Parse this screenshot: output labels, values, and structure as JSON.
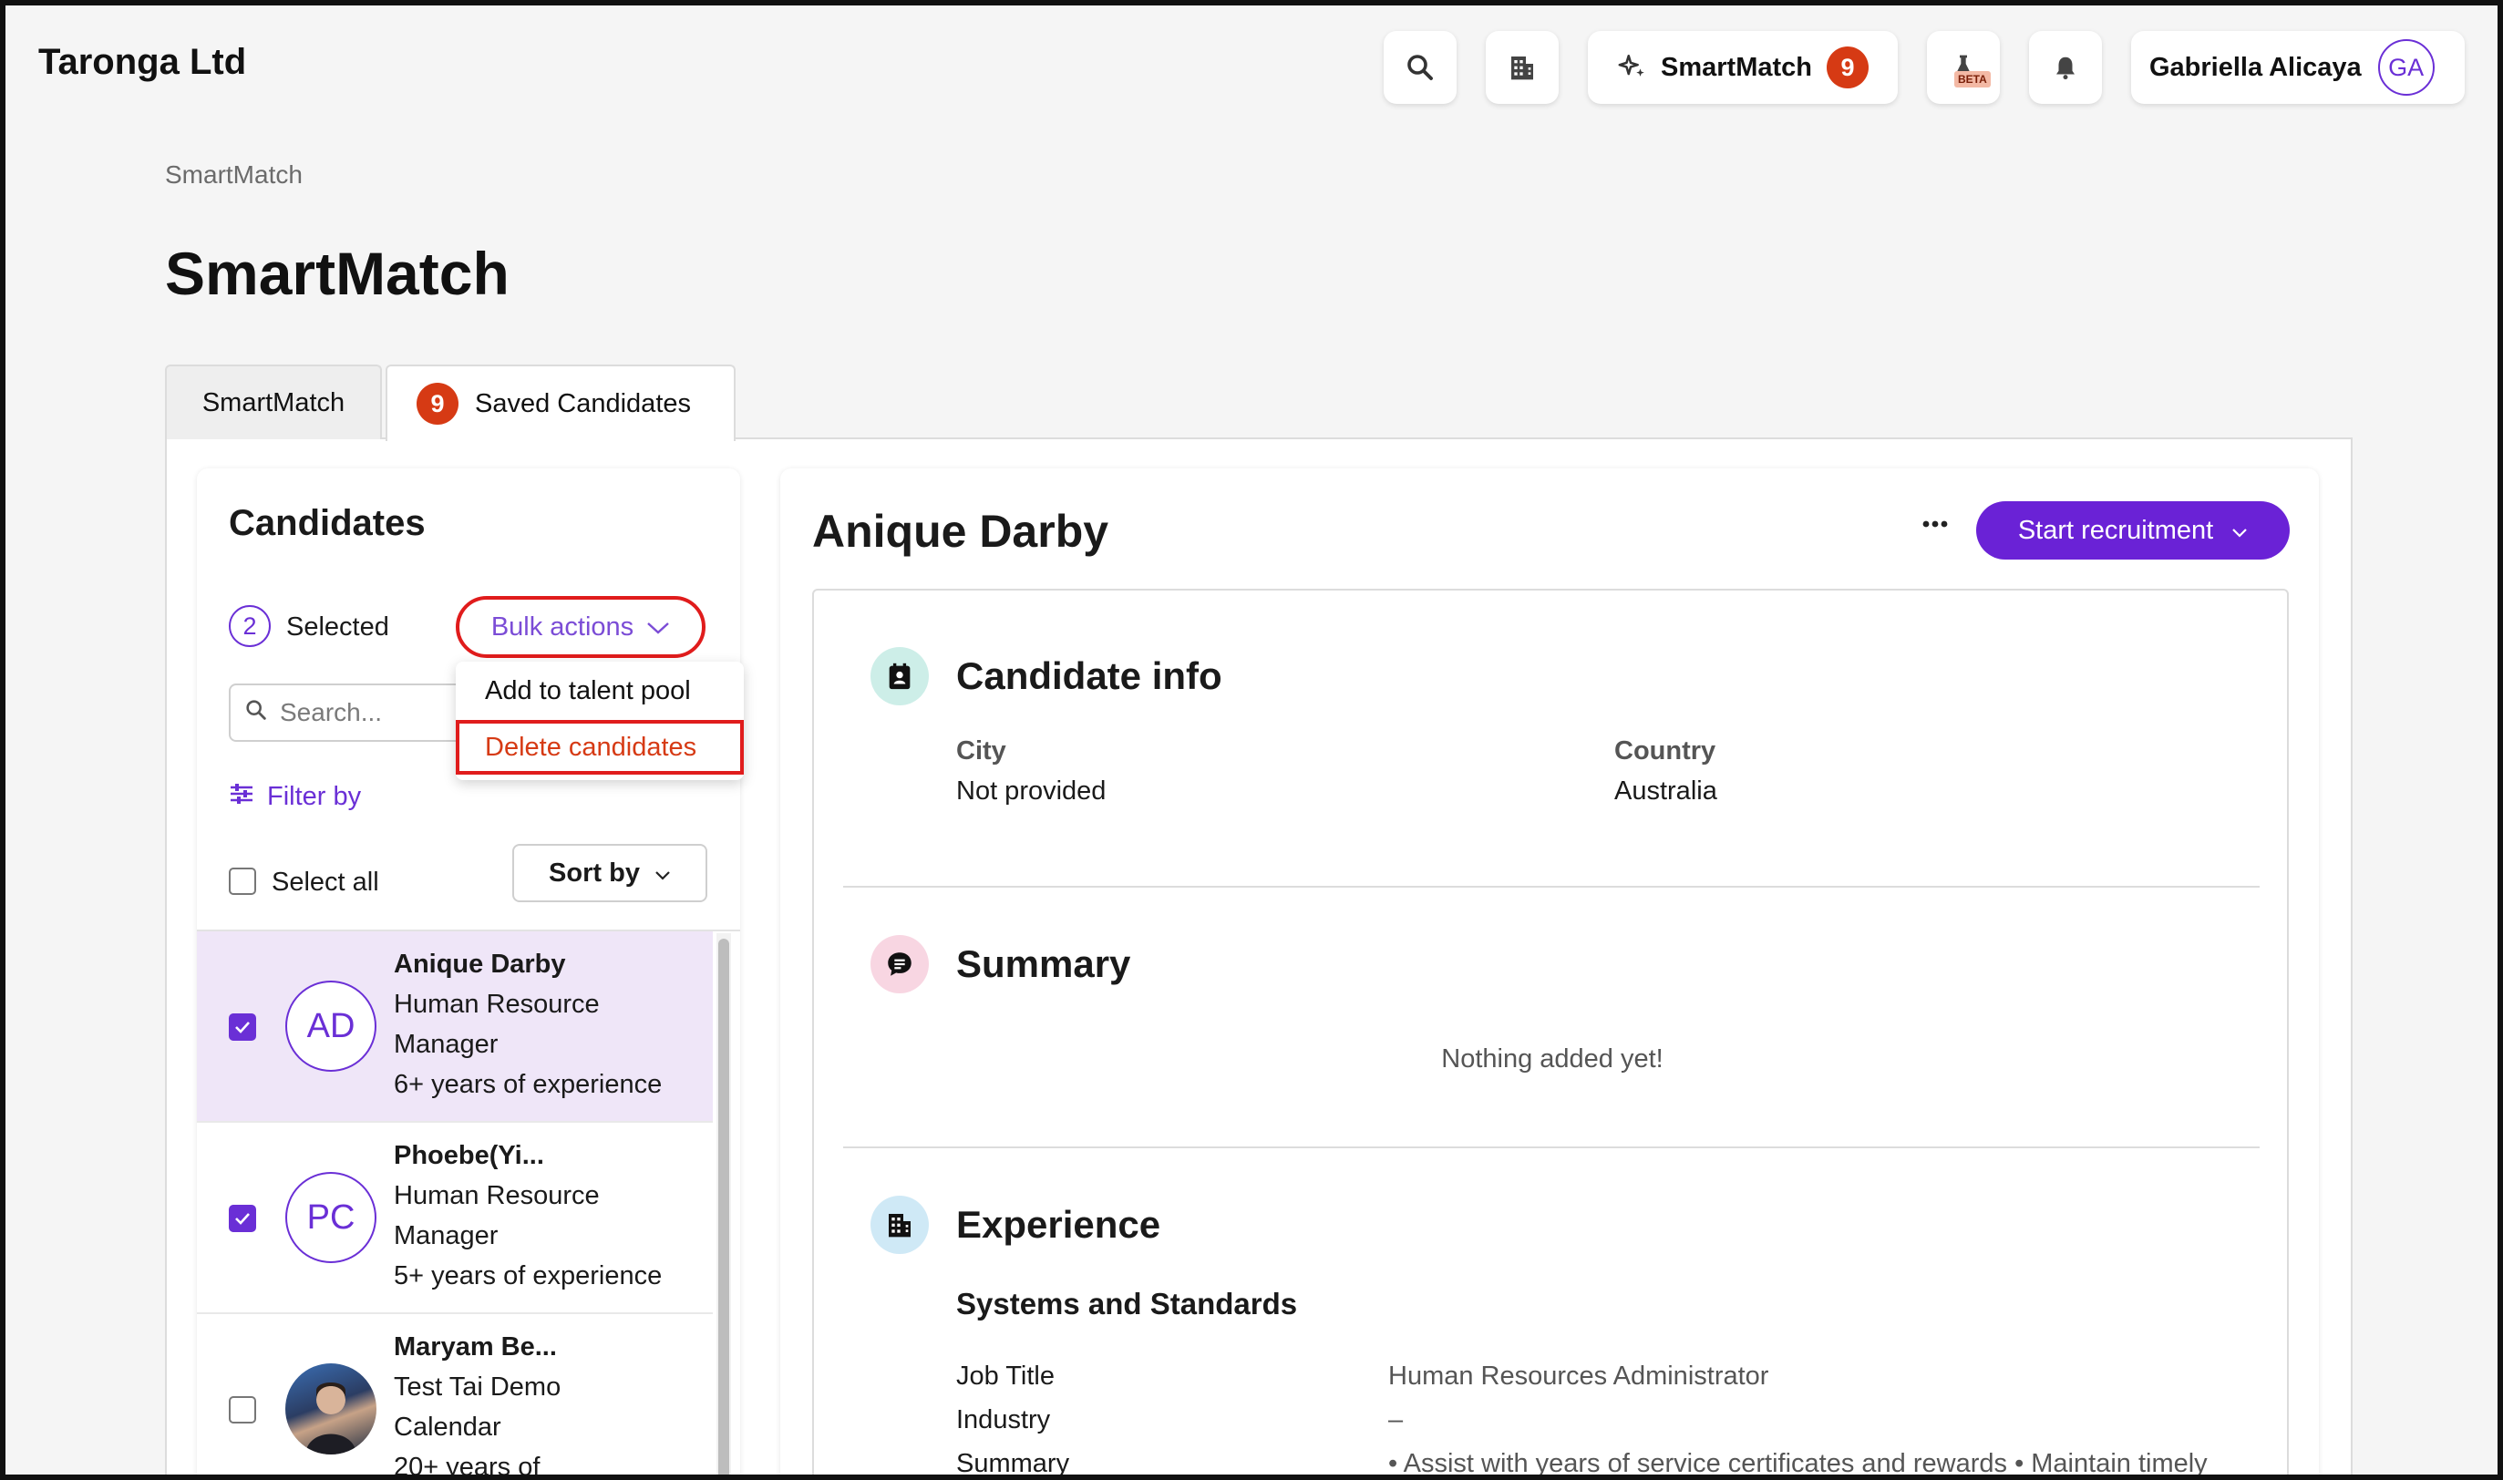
{
  "header": {
    "brand": "Taronga Ltd",
    "smartmatch_label": "SmartMatch",
    "smartmatch_count": "9",
    "beta_label": "BETA",
    "user_name": "Gabriella Alicaya",
    "user_initials": "GA"
  },
  "breadcrumb": "SmartMatch",
  "page_title": "SmartMatch",
  "tabs": [
    {
      "label": "SmartMatch"
    },
    {
      "label": "Saved Candidates",
      "badge": "9"
    }
  ],
  "candidates": {
    "title": "Candidates",
    "selected_count": "2",
    "selected_label": "Selected",
    "bulk_actions_label": "Bulk actions",
    "bulk_menu": [
      "Add to talent pool",
      "Delete candidates"
    ],
    "search_placeholder": "Search...",
    "filter_label": "Filter by",
    "select_all_label": "Select all",
    "sort_label": "Sort by",
    "list": [
      {
        "initials": "AD",
        "name": "Anique Darby",
        "role_line1": "Human Resource",
        "role_line2": "Manager",
        "experience": "6+ years of experience",
        "checked": true
      },
      {
        "initials": "PC",
        "name": "Phoebe(Yi...",
        "role_line1": "Human Resource",
        "role_line2": "Manager",
        "experience": "5+ years of experience",
        "checked": true
      },
      {
        "initials": "",
        "name": "Maryam Be...",
        "role_line1": "Test Tai Demo",
        "role_line2": "Calendar",
        "experience": "20+ years of",
        "checked": false
      }
    ]
  },
  "detail": {
    "name": "Anique Darby",
    "start_button": "Start recruitment",
    "candidate_info": {
      "title": "Candidate info",
      "city_label": "City",
      "city_value": "Not provided",
      "country_label": "Country",
      "country_value": "Australia"
    },
    "summary": {
      "title": "Summary",
      "empty_text": "Nothing added yet!"
    },
    "experience": {
      "title": "Experience",
      "company": "Systems and Standards",
      "job_title_label": "Job Title",
      "job_title_value": "Human Resources Administrator",
      "industry_label": "Industry",
      "industry_value": "–",
      "summary_label": "Summary",
      "summary_value": "• Assist with years of service certificates and rewards • Maintain timely"
    }
  },
  "colors": {
    "accent": "#6a22d6",
    "badge": "#d63a14",
    "highlight": "#e01c1c",
    "selected_row": "#efe6f8"
  }
}
